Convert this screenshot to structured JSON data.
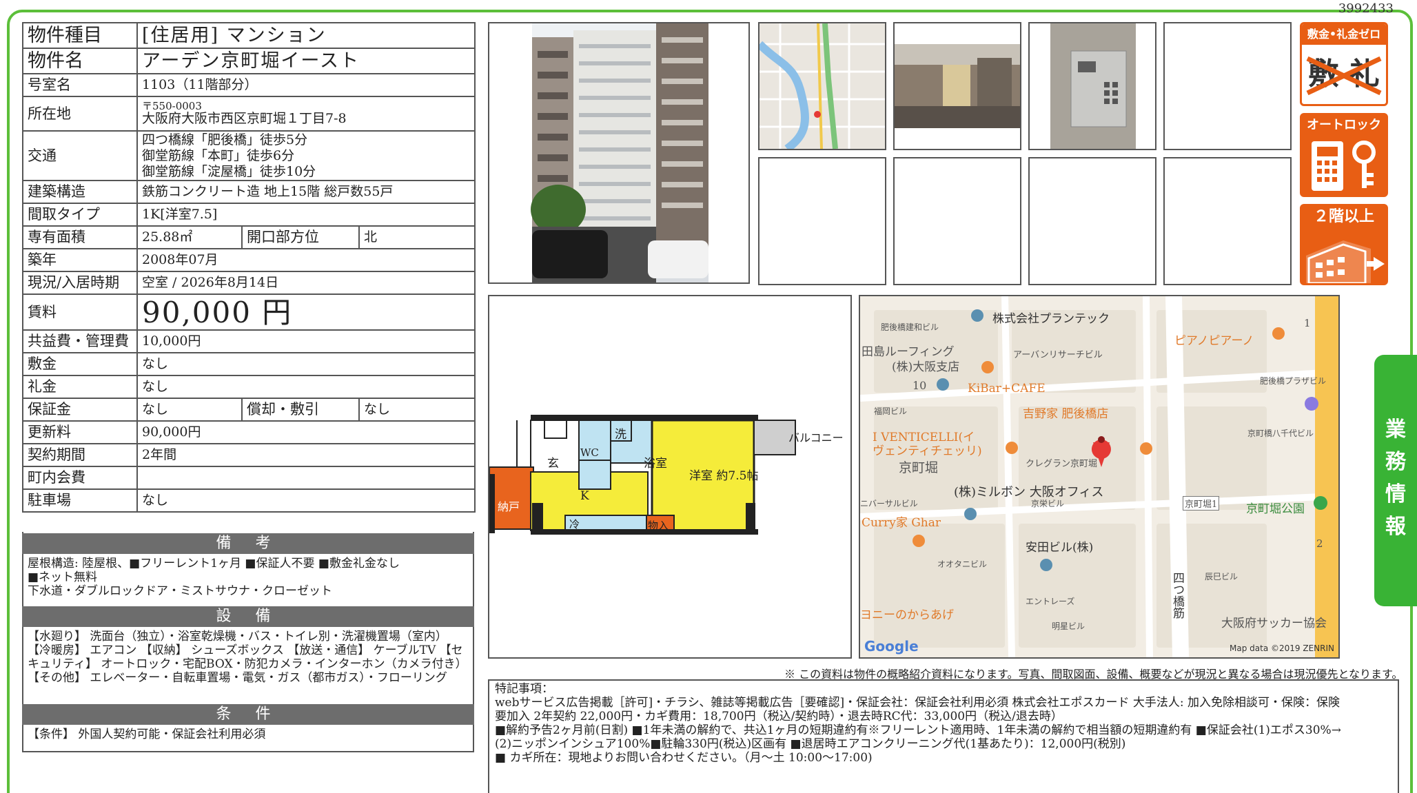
{
  "doc_id": "3992433",
  "property": {
    "type_label": "物件種目",
    "type_value": "[住居用] マンション",
    "name_label": "物件名",
    "name_value": "アーデン京町堀イースト",
    "room_label": "号室名",
    "room_value": "1103（11階部分）",
    "address_label": "所在地",
    "postal": "〒550-0003",
    "address": "大阪府大阪市西区京町堀１丁目7-8",
    "transit_label": "交通",
    "transit": [
      "四つ橋線「肥後橋」徒歩5分",
      "御堂筋線「本町」徒歩6分",
      "御堂筋線「淀屋橋」徒歩10分"
    ],
    "structure_label": "建築構造",
    "structure_value": "鉄筋コンクリート造 地上15階 総戸数55戸",
    "layout_label": "間取タイプ",
    "layout_value": "1K[洋室7.5]",
    "area_label": "専有面積",
    "area_value": "25.88㎡",
    "direction_label": "開口部方位",
    "direction_value": "北",
    "built_label": "築年",
    "built_value": "2008年07月",
    "status_label": "現況/入居時期",
    "status_value": "空室 / 2026年8月14日",
    "rent_label": "賃料",
    "rent_value": "90,000 円",
    "fee_label": "共益費・管理費",
    "fee_value": "10,000円",
    "deposit_label": "敷金",
    "deposit_value": "なし",
    "keymoney_label": "礼金",
    "keymoney_value": "なし",
    "guarantee_label": "保証金",
    "guarantee_value": "なし",
    "amort_label": "償却・敷引",
    "amort_value": "なし",
    "renewal_label": "更新料",
    "renewal_value": "90,000円",
    "contract_label": "契約期間",
    "contract_value": "2年間",
    "town_label": "町内会費",
    "town_value": "",
    "parking_label": "駐車場",
    "parking_value": "なし"
  },
  "sections": {
    "biko_title": "備 考",
    "biko_lines": [
      "屋根構造: 陸屋根、■フリーレント1ヶ月 ■保証人不要 ■敷金礼金なし",
      "■ネット無料",
      "下水道・ダブルロックドア・ミストサウナ・クローゼット"
    ],
    "setsubi_title": "設 備",
    "setsubi_text": "【水廻り】 洗面台（独立）・浴室乾燥機・バス・トイレ別・洗濯機置場（室内） 【冷暖房】 エアコン 【収納】 シューズボックス 【放送・通信】 ケーブルTV 【セキュリティ】 オートロック・宅配BOX・防犯カメラ・インターホン（カメラ付き） 【その他】 エレベーター・自転車置場・電気・ガス（都市ガス）・フローリング",
    "joken_title": "条 件",
    "joken_text": "【条件】 外国人契約可能・保証会社利用必須"
  },
  "badges": {
    "b1_title": "敷金•礼金ゼロ",
    "b1_glyph": "敷 礼",
    "b2_title": "オートロック",
    "b3_title": "２階以上"
  },
  "floorplan": {
    "genkan": "玄",
    "wc": "WC",
    "sen": "洗",
    "yokushitsu": "浴室",
    "youshitsu": "洋室 約7.5帖",
    "balcony": "バルコニー",
    "k": "K",
    "rei": "冷",
    "nando": "納戸",
    "monoire": "物入"
  },
  "map": {
    "labels": [
      "株式会社プランテック",
      "肥後橋建和ビル",
      "田島ルーフィング",
      "(株)大阪支店",
      "アーバンリサーチビル",
      "10",
      "KiBar+CAFE",
      "福岡ビル",
      "吉野家 肥後橋店",
      "I VENTICELLI(イ",
      "ヴェンティチェッリ)",
      "京町堀",
      "クレグラン京町堀",
      "(株)ミルボン 大阪オフィス",
      "京栄ビル",
      "ニバーサルビル",
      "Curry家 Ghar",
      "安田ビル(株)",
      "オオタニビル",
      "ヨニーのからあげ",
      "エントレーズ",
      "明星ビル",
      "ピアノピアーノ",
      "肥後橋プラザビル",
      "京町橋八千代ビル",
      "京町堀1",
      "京町堀公園",
      "辰巳ビル",
      "大阪府サッカー協会",
      "四つ橋筋",
      "1",
      "2"
    ],
    "google": "Google",
    "attribution": "Map data ©2019 ZENRIN"
  },
  "side_tab": "業務情報",
  "footnote": "※ この資料は物件の概略紹介資料になります。写真、間取図面、設備、概要などが現況と異なる場合は現況優先となります。",
  "remarks": {
    "title": "特記事項：",
    "lines": [
      "webサービス広告掲載［許可]・チラシ、雑誌等掲載広告［要確認]・保証会社：保証会社利用必須 株式会社エポスカード 大手法人: 加入免除相談可・保険：保険",
      "要加入 2年契約 22,000円・カギ費用：18,700円（税込/契約時）・退去時RC代：33,000円（税込/退去時）",
      "■解約予告2ヶ月前(日割) ■1年未満の解約で、共込1ヶ月の短期違約有※フリーレント適用時、1年未満の解約で相当額の短期違約有 ■保証会社(1)エポス30%→",
      "(2)ニッポンインシュア100%■駐輪330円(税込)区画有 ■退居時エアコンクリーニング代(1基あたり)：12,000円(税別)",
      "■ カギ所在：現地よりお問い合わせください。（月〜土 10:00〜17:00)"
    ]
  },
  "colors": {
    "frame": "#5cbf3a",
    "badge": "#e85e14",
    "section": "#6d6d6d",
    "plan_yellow": "#f5ec3a",
    "plan_blue": "#bfe3f2",
    "plan_orange": "#e8641e"
  }
}
